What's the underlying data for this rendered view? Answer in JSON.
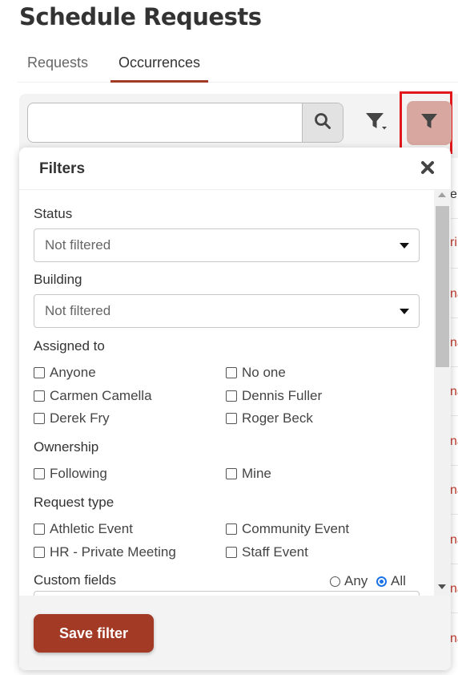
{
  "page_title": "Schedule Requests",
  "tabs": [
    {
      "label": "Requests",
      "active": false
    },
    {
      "label": "Occurrences",
      "active": true
    }
  ],
  "search": {
    "value": "",
    "placeholder": ""
  },
  "icons": {
    "search": "search-icon",
    "filter_menu": "filter-dropdown-icon",
    "filter": "filter-icon",
    "close": "close-icon"
  },
  "colors": {
    "accent": "#a33a25",
    "filter_button_bg": "#d8a8a0",
    "highlight_outline": "#e1181c",
    "radio_selected": "#1a73e8"
  },
  "background_list": {
    "header_fragment": "e",
    "cells": [
      "ri",
      "na",
      "na",
      "na",
      "na",
      "na",
      "na",
      "na",
      "na"
    ]
  },
  "filters": {
    "title": "Filters",
    "status": {
      "label": "Status",
      "value": "Not filtered"
    },
    "building": {
      "label": "Building",
      "value": "Not filtered"
    },
    "assigned_to": {
      "label": "Assigned to",
      "options": [
        "Anyone",
        "No one",
        "Carmen Camella",
        "Dennis Fuller",
        "Derek Fry",
        "Roger Beck"
      ]
    },
    "ownership": {
      "label": "Ownership",
      "options": [
        "Following",
        "Mine"
      ]
    },
    "request_type": {
      "label": "Request type",
      "options": [
        "Athletic Event",
        "Community Event",
        "HR - Private Meeting",
        "Staff Event"
      ]
    },
    "custom_fields": {
      "label": "Custom fields",
      "any_label": "Any",
      "all_label": "All",
      "selected": "All"
    },
    "save_label": "Save filter"
  }
}
